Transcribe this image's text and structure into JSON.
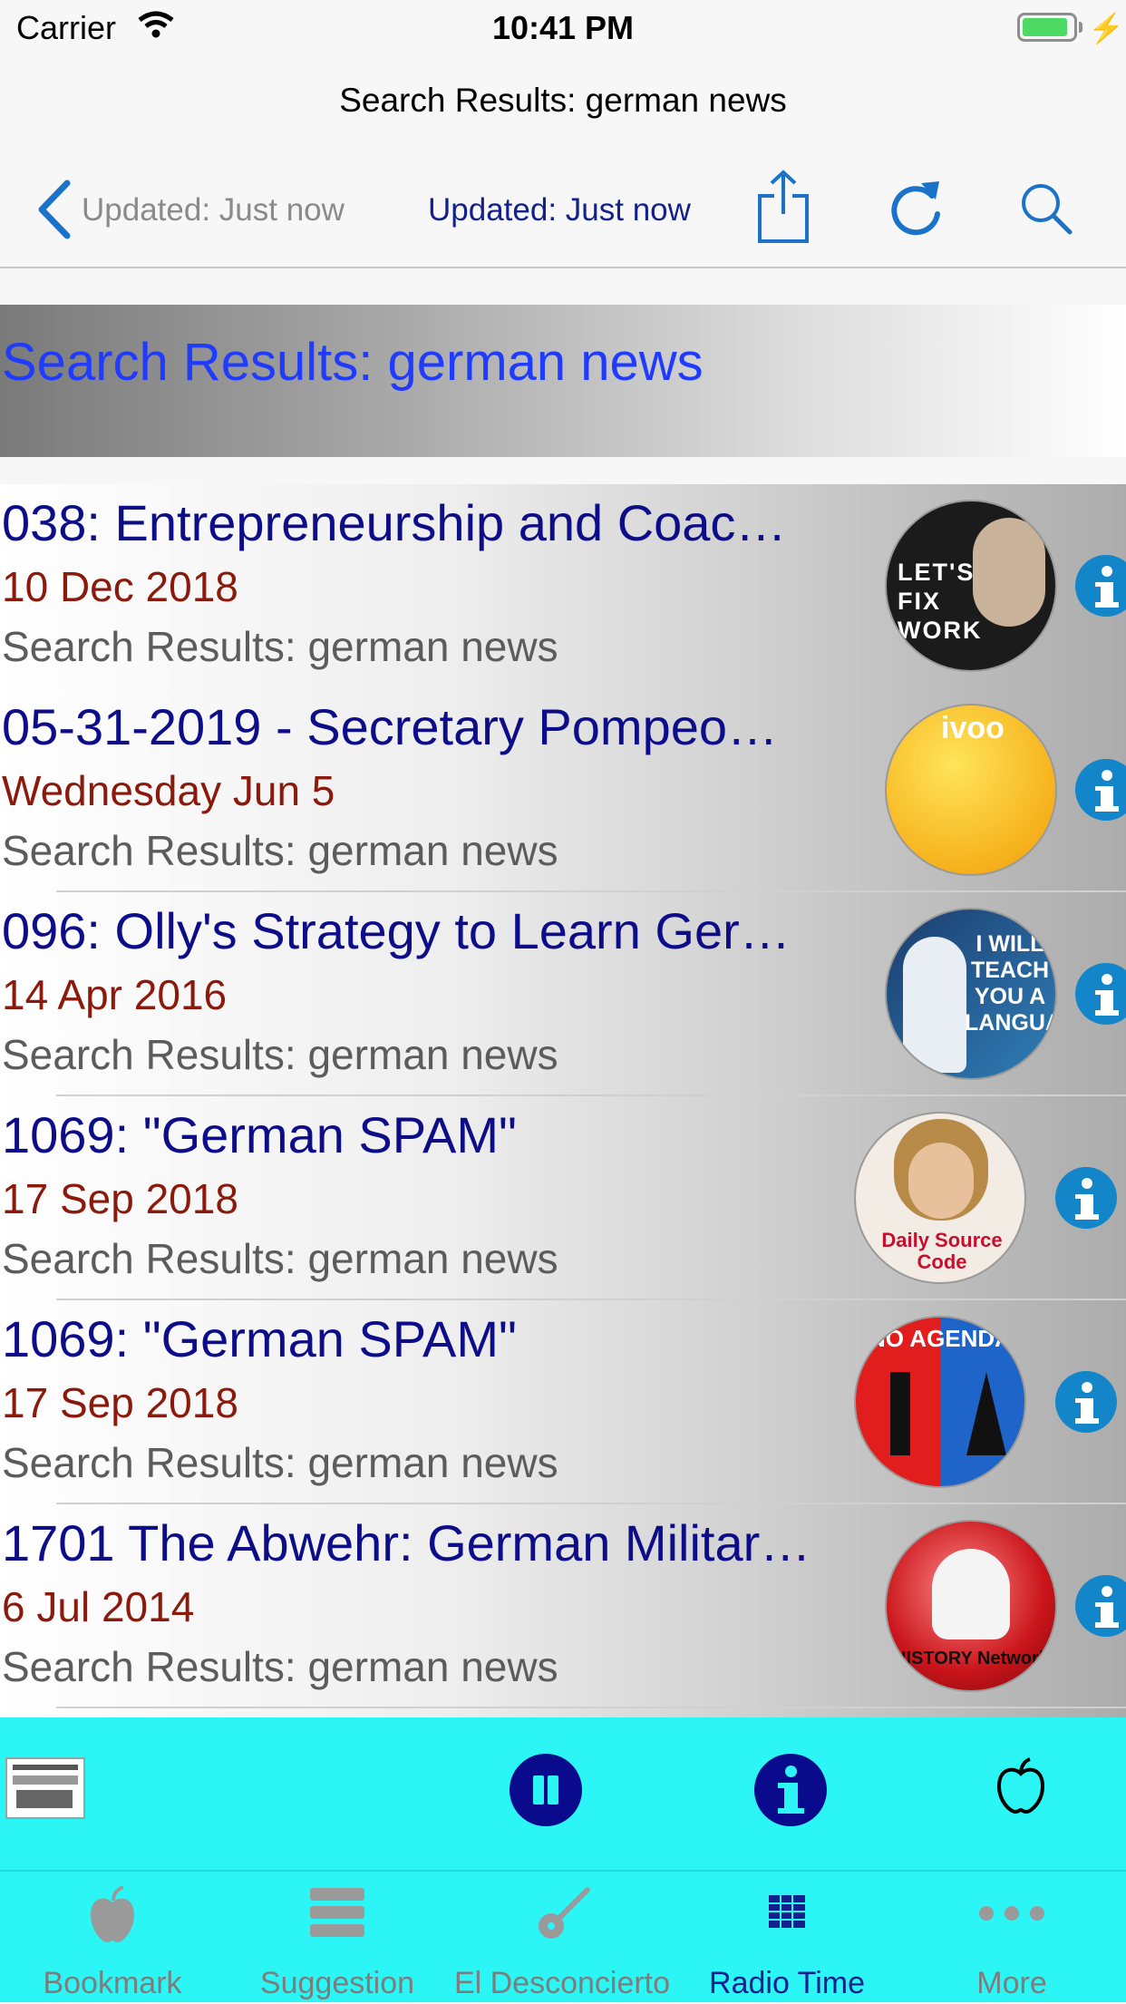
{
  "status_bar": {
    "carrier": "Carrier",
    "time": "10:41 PM"
  },
  "nav": {
    "title": "Search Results: german news",
    "back_label": "Updated: Just now",
    "center_label": "Updated: Just now",
    "icons": [
      "share-icon",
      "refresh-icon",
      "search-icon"
    ]
  },
  "section_header": "Search Results: german news",
  "rows": [
    {
      "title": "038: Entrepreneurship and Coac…",
      "date": "10 Dec 2018",
      "subtitle": "Search Results: german news",
      "thumb_text": "LET'S FIX WORK"
    },
    {
      "title": "05-31-2019 - Secretary Pompeo…",
      "date": "Wednesday Jun 5",
      "subtitle": "Search Results: german news",
      "thumb_text": "ivoo"
    },
    {
      "title": "096: Olly's Strategy to Learn Ger…",
      "date": "14 Apr 2016",
      "subtitle": "Search Results: german news",
      "thumb_text": "I WILL TEACH YOU A LANGUAGE"
    },
    {
      "title": "1069: \"German SPAM\"",
      "date": "17 Sep 2018",
      "subtitle": "Search Results: german news",
      "thumb_text": "Daily Source Code"
    },
    {
      "title": "1069: \"German SPAM\"",
      "date": "17 Sep 2018",
      "subtitle": "Search Results: german news",
      "thumb_text": "NO AGENDA"
    },
    {
      "title": "1701 The Abwehr: German Militar…",
      "date": "6 Jul 2014",
      "subtitle": "Search Results: german news",
      "thumb_text": "HISTORY Network"
    }
  ],
  "tabs": [
    {
      "label": "Bookmark",
      "icon": "apple-icon",
      "active": false
    },
    {
      "label": "Suggestion",
      "icon": "stack-icon",
      "active": false
    },
    {
      "label": "El Desconcierto",
      "icon": "guitar-icon",
      "active": false
    },
    {
      "label": "Radio Time",
      "icon": "grid-icon",
      "active": true
    },
    {
      "label": "More",
      "icon": "more-icon",
      "active": false
    }
  ],
  "colors": {
    "title": "#0d0d8a",
    "date": "#8b1a0c",
    "subtitle": "#5c5c5c",
    "header_text": "#1f3bff",
    "accent_bar": "#2bf5f5",
    "nav_blue": "#1a73c9"
  }
}
